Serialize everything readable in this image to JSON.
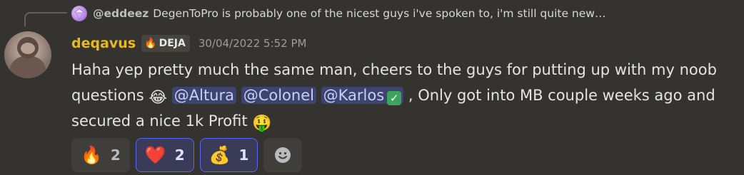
{
  "reply": {
    "username": "@eddeez",
    "text": "DegenToPro is probably one of the nicest guys i've spoken to, i'm still quite new…"
  },
  "author": {
    "username": "deqavus",
    "badge": "DEJA",
    "timestamp": "30/04/2022 5:52 PM"
  },
  "message": {
    "text_1": "Haha yep pretty much the same man, cheers to the guys for putting up with my noob questions ",
    "emoji_joy": "😂",
    "mentions": [
      "@Altura",
      "@Colonel",
      "@Karlos"
    ],
    "text_2": " , Only got into MB couple weeks ago and secured a nice 1k Profit ",
    "emoji_money": "🤑"
  },
  "reactions": [
    {
      "emoji": "🔥",
      "count": "2",
      "active": false
    },
    {
      "emoji": "❤️",
      "count": "2",
      "active": true
    },
    {
      "emoji": "💰",
      "count": "1",
      "active": true
    }
  ],
  "colors": {
    "background": "#34332f",
    "username": "#e7b91e",
    "mention_bg": "#3d456e",
    "active_reaction_border": "#5865f2"
  }
}
